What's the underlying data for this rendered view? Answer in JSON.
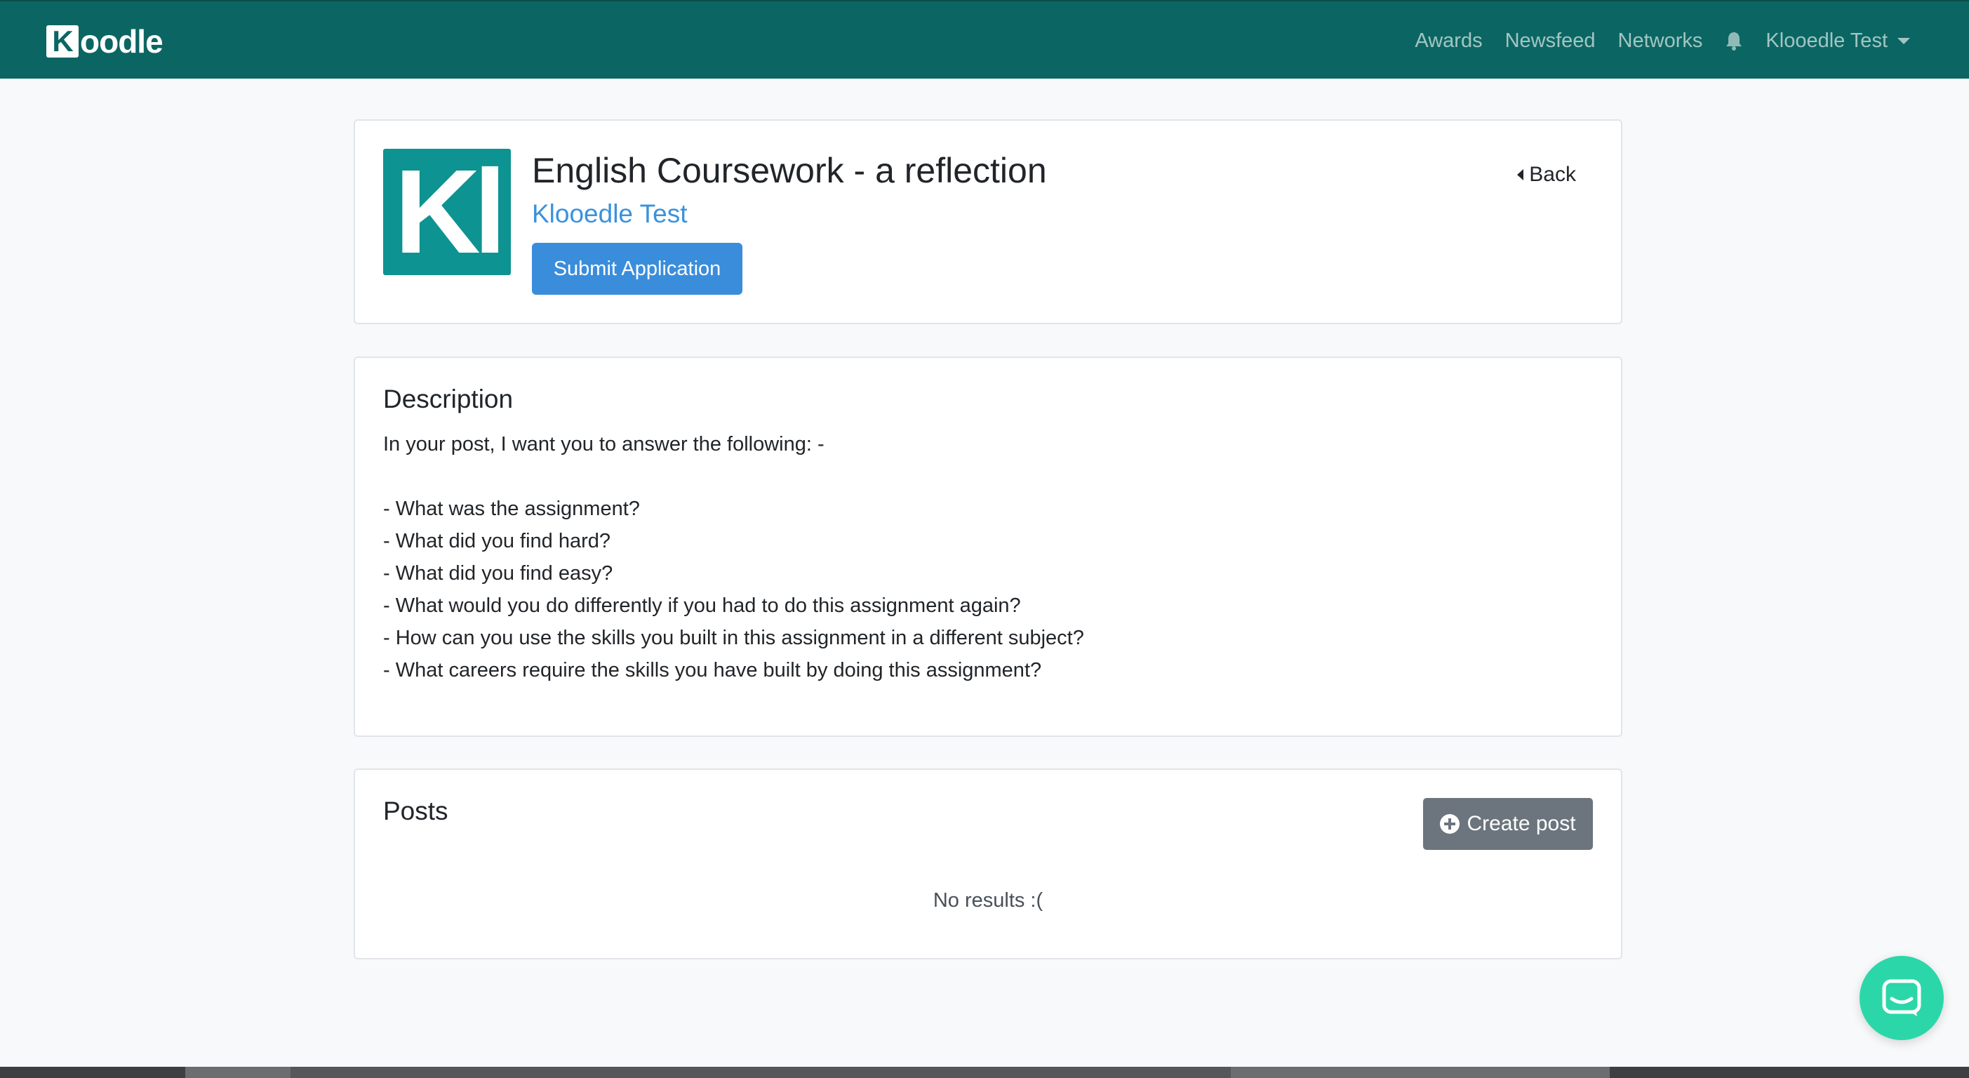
{
  "navbar": {
    "brand_initial": "K",
    "brand_rest": "oodle",
    "links": [
      "Awards",
      "Newsfeed",
      "Networks"
    ],
    "notification_icon": "bell-icon",
    "user_menu": "Klooedle Test"
  },
  "header": {
    "logo_text": "Kl",
    "title": "English Coursework - a reflection",
    "owner": "Klooedle Test",
    "submit_label": "Submit Application",
    "back_label": "Back"
  },
  "description": {
    "title": "Description",
    "body": "In your post, I want you to answer the following: -\n\n- What was the assignment?\n- What did you find hard?\n- What did you find easy?\n- What would you do differently if you had to do this assignment again?\n- How can you use the skills you built in this assignment in a different subject?\n- What careers require the skills you have built by doing this assignment?"
  },
  "posts": {
    "title": "Posts",
    "create_label": "Create post",
    "empty_text": "No results :("
  },
  "colors": {
    "navbar": "#0b6663",
    "accent": "#3a8ddb",
    "logo": "#0d9391",
    "chat": "#2bd7a9"
  }
}
